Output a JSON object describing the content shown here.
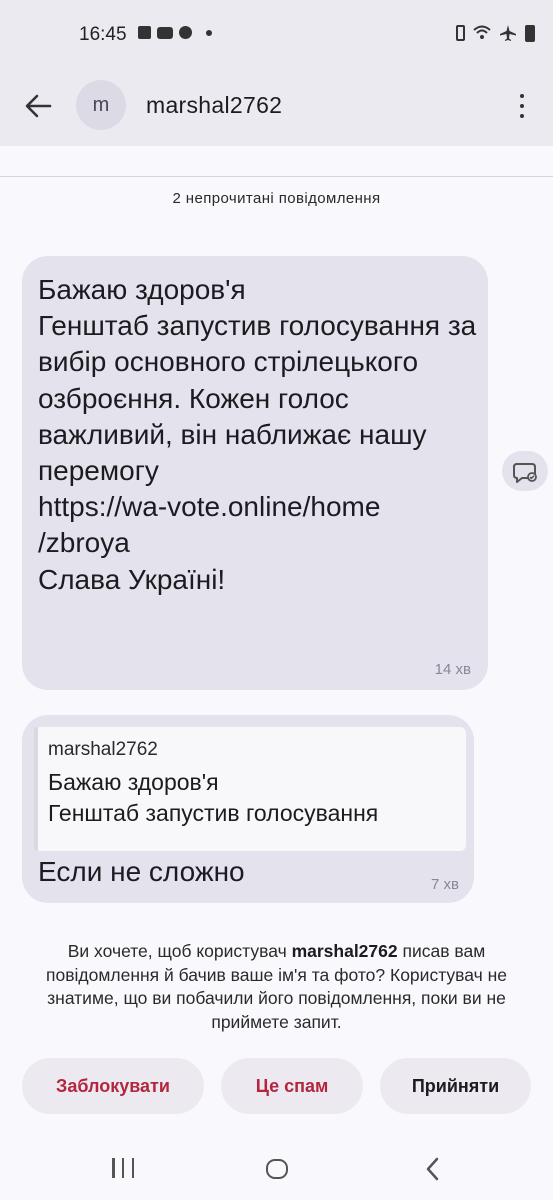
{
  "status_bar": {
    "time": "16:45",
    "left_icons": [
      "gallery-icon",
      "youtube-icon",
      "app-icon",
      "dot-icon"
    ],
    "right_icons": [
      "battery-saver-icon",
      "wifi-icon",
      "airplane-icon",
      "battery-icon"
    ]
  },
  "header": {
    "avatar_letter": "m",
    "contact_name": "marshal2762",
    "icons": [
      "back-arrow-icon",
      "more-vertical-icon"
    ]
  },
  "unread_banner": "2 непрочитані повідомлення",
  "messages": [
    {
      "text": "Бажаю здоров'я\nГенштаб запустив голосування за вибір основного стрілецького озброєння. Кожен голос важливий, він наближає нашу перемогу\nhttps://wa-vote.online/home\n/zbroya\nСлава Україні!",
      "time": "14 хв"
    },
    {
      "quote_author": "marshal2762",
      "quote_text": "Бажаю здоров'я\nГенштаб запустив голосування",
      "text": "Если не сложно",
      "time": "7 хв"
    }
  ],
  "request": {
    "prefix": "Ви хочете, щоб користувач ",
    "username": "marshal2762",
    "suffix": " писав вам повідомлення й бачив ваше ім'я та фото? Користувач не знатиме, що ви побачили його повідомлення, поки ви не приймете запит."
  },
  "actions": {
    "block": "Заблокувати",
    "spam": "Це спам",
    "accept": "Прийняти"
  },
  "colors": {
    "danger": "#b3263e",
    "bubble": "#e4e2ec",
    "header_bg": "#eceaf1"
  }
}
